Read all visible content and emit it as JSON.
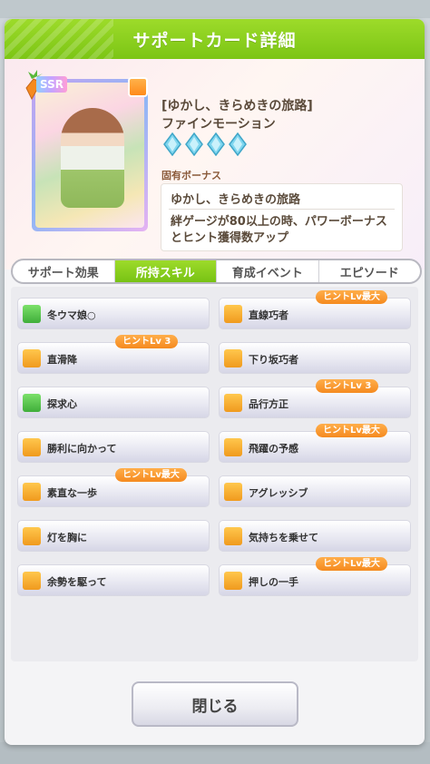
{
  "header": {
    "title": "サポートカード詳細"
  },
  "card": {
    "rarity": "SSR",
    "name": "[ゆかし、きらめきの旅路]",
    "character": "ファインモーション",
    "unique_bonus_label": "固有ボーナス",
    "bonus_name": "ゆかし、きらめきの旅路",
    "bonus_desc": "絆ゲージが80以上の時、パワーボーナスとヒント獲得数アップ",
    "level_diamonds": 4
  },
  "tabs": [
    {
      "label": "サポート効果"
    },
    {
      "label": "所持スキル"
    },
    {
      "label": "育成イベント"
    },
    {
      "label": "エピソード"
    }
  ],
  "skills": [
    {
      "name": "冬ウマ娘○",
      "icon": "green-skill-icon"
    },
    {
      "name": "直線巧者",
      "icon": "gold-skill-icon",
      "hint": "ヒントLv最大"
    },
    {
      "name": "直滑降",
      "icon": "gold-skill-icon",
      "hint": "ヒントLv 3"
    },
    {
      "name": "下り坂巧者",
      "icon": "gold-skill-icon"
    },
    {
      "name": "探求心",
      "icon": "green-skill-icon"
    },
    {
      "name": "品行方正",
      "icon": "gold-skill-icon",
      "hint": "ヒントLv 3"
    },
    {
      "name": "勝利に向かって",
      "icon": "gold-skill-icon"
    },
    {
      "name": "飛躍の予感",
      "icon": "gold-skill-icon",
      "hint": "ヒントLv最大"
    },
    {
      "name": "素直な一歩",
      "icon": "gold-skill-icon",
      "hint": "ヒントLv最大"
    },
    {
      "name": "アグレッシブ",
      "icon": "gold-skill-icon"
    },
    {
      "name": "灯を胸に",
      "icon": "gold-skill-icon"
    },
    {
      "name": "気持ちを乗せて",
      "icon": "gold-skill-icon"
    },
    {
      "name": "余勢を駆って",
      "icon": "gold-skill-icon"
    },
    {
      "name": "押しの一手",
      "icon": "gold-skill-icon",
      "hint": "ヒントLv最大"
    }
  ],
  "close_label": "閉じる",
  "colors": {
    "accent": "#8ccf1f",
    "hint_badge": "#f58a1f"
  }
}
